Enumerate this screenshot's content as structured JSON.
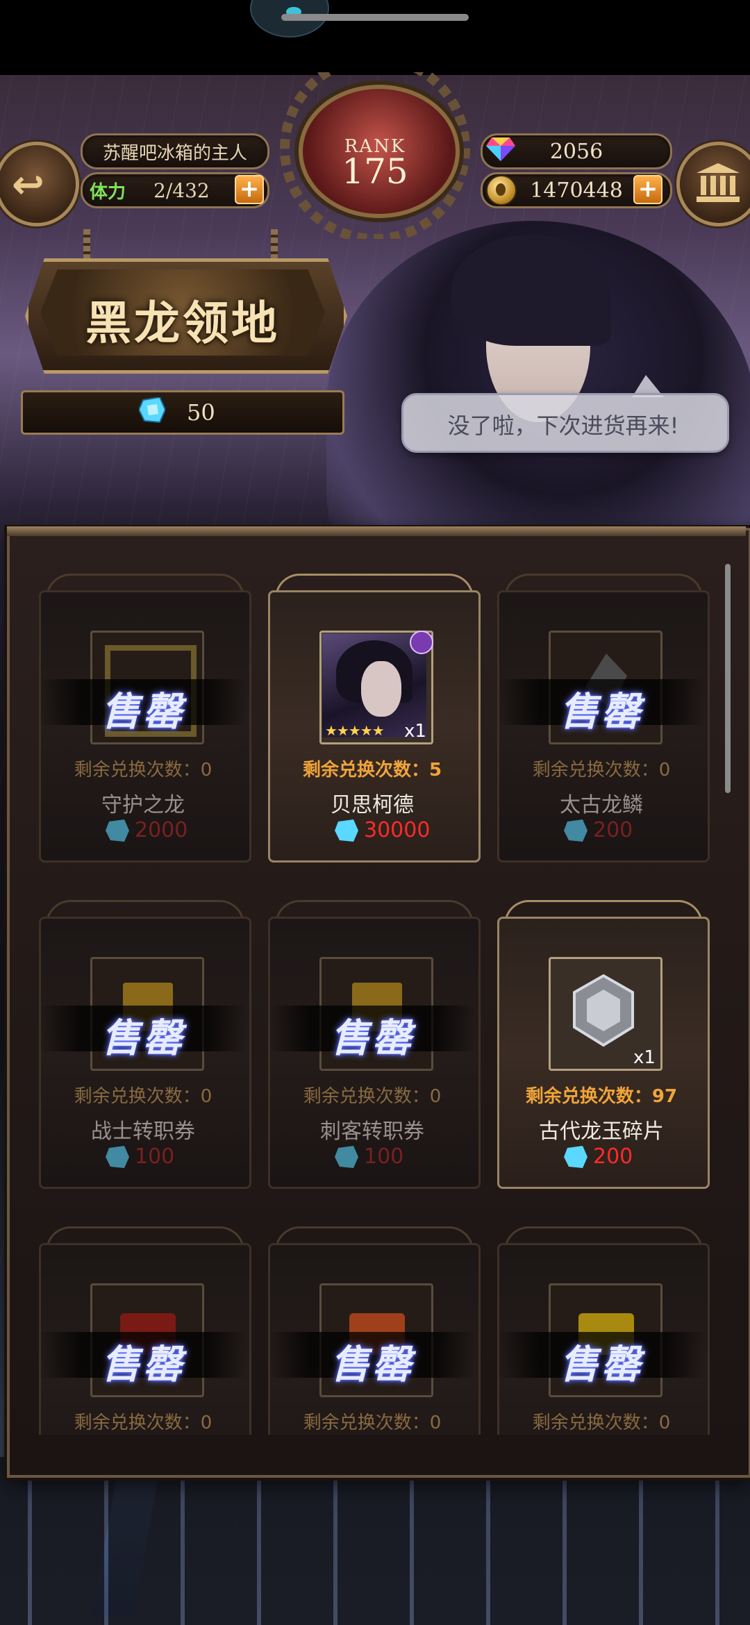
{
  "header": {
    "player_name": "苏醒吧冰箱的主人",
    "stamina_label": "体力",
    "stamina_value": "2/432",
    "rank_label": "RANK",
    "rank_value": "175",
    "gems": "2056",
    "gold": "1470448"
  },
  "shop": {
    "title": "黑龙领地",
    "currency_balance": "50",
    "npc_message": "没了啦，下次进货再来!"
  },
  "colors": {
    "sold_out_glow": "#6a7cff",
    "remaining_orange": "#f0a43a",
    "price_red": "#ff2a2a"
  },
  "items": [
    {
      "name": "守护之龙",
      "remaining": "剩余兑换次数：0",
      "price": "2000",
      "sold_out": true,
      "sold_out_text": "售罄",
      "icon": "frame-icon"
    },
    {
      "name": "贝思柯德",
      "remaining": "剩余兑换次数：5",
      "price": "30000",
      "sold_out": false,
      "qty": "x1",
      "stars": "★★★★★",
      "icon": "hero-portrait"
    },
    {
      "name": "太古龙鳞",
      "remaining": "剩余兑换次数：0",
      "price": "200",
      "sold_out": true,
      "sold_out_text": "售罄",
      "icon": "scale-icon"
    },
    {
      "name": "战士转职券",
      "remaining": "剩余兑换次数：0",
      "price": "100",
      "sold_out": true,
      "sold_out_text": "售罄",
      "icon": "scroll-icon"
    },
    {
      "name": "刺客转职券",
      "remaining": "剩余兑换次数：0",
      "price": "100",
      "sold_out": true,
      "sold_out_text": "售罄",
      "icon": "scroll-icon"
    },
    {
      "name": "古代龙玉碎片",
      "remaining": "剩余兑换次数：97",
      "price": "200",
      "sold_out": false,
      "qty": "x1",
      "icon": "jade-shard-icon"
    },
    {
      "remaining": "剩余兑换次数：0",
      "sold_out": true,
      "sold_out_text": "售罄",
      "icon": "red-scroll-icon"
    },
    {
      "remaining": "剩余兑换次数：0",
      "sold_out": true,
      "sold_out_text": "售罄",
      "icon": "orange-scroll-icon"
    },
    {
      "remaining": "剩余兑换次数：0",
      "sold_out": true,
      "sold_out_text": "售罄",
      "icon": "yellow-scroll-icon"
    }
  ]
}
